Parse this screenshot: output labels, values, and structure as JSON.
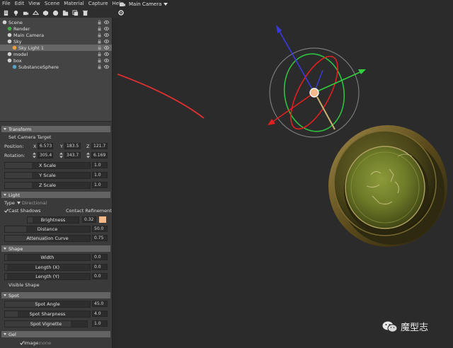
{
  "menu": [
    "File",
    "Edit",
    "View",
    "Scene",
    "Material",
    "Capture",
    "Help"
  ],
  "viewport": {
    "camera_label": "Main Camera"
  },
  "outliner": {
    "items": [
      {
        "label": "Scene",
        "depth": 0,
        "selected": false
      },
      {
        "label": "Render",
        "depth": 1,
        "selected": false
      },
      {
        "label": "Main Camera",
        "depth": 1,
        "selected": false
      },
      {
        "label": "Sky",
        "depth": 1,
        "selected": false
      },
      {
        "label": "Sky Light 1",
        "depth": 2,
        "selected": true
      },
      {
        "label": "model",
        "depth": 1,
        "selected": false
      },
      {
        "label": "box",
        "depth": 1,
        "selected": false
      },
      {
        "label": "SubstanceSphere",
        "depth": 2,
        "selected": false
      }
    ]
  },
  "transform": {
    "header": "Transform",
    "set_camera_target": "Set Camera Target",
    "position_label": "Position:",
    "rotation_label": "Rotation:",
    "x_label": "X",
    "y_label": "Y",
    "z_label": "Z",
    "position": {
      "x": "6.573",
      "y": "183.5",
      "z": "121.7"
    },
    "rotation": {
      "x": "305.4",
      "y": "343.7",
      "z": "6.169"
    },
    "x_scale": {
      "label": "X Scale",
      "value": "1.0"
    },
    "y_scale": {
      "label": "Y Scale",
      "value": "1.0"
    },
    "z_scale": {
      "label": "Z Scale",
      "value": "1.0"
    }
  },
  "light": {
    "header": "Light",
    "type_label": "Type",
    "type_value": "Directional",
    "cast_shadows": "Cast Shadows",
    "contact_refinement": "Contact Refinement",
    "brightness": {
      "label": "Brightness",
      "value": "0.32",
      "fill": 0.1
    },
    "distance": {
      "label": "Distance",
      "value": "50.0",
      "fill": 0.25
    },
    "attenuation": {
      "label": "Attenuation Curve",
      "value": "0.75",
      "fill": 0.5
    },
    "color": "#f5b98a"
  },
  "shape": {
    "header": "Shape",
    "width": {
      "label": "Width",
      "value": "0.0"
    },
    "length_x": {
      "label": "Length (X)",
      "value": "0.0"
    },
    "length_y": {
      "label": "Length (Y)",
      "value": "0.0"
    },
    "visible_shape": "Visible Shape"
  },
  "spot": {
    "header": "Spot",
    "angle": {
      "label": "Spot Angle",
      "value": "45.0",
      "fill": 0.4
    },
    "sharpness": {
      "label": "Spot Sharpness",
      "value": "4.0",
      "fill": 0.15
    },
    "vignette": {
      "label": "Spot Vignette",
      "value": "1.0",
      "fill": 0.8
    }
  },
  "gel": {
    "header": "Gel",
    "image_label": "Image:",
    "image_value": "none"
  },
  "watermark": {
    "text": "魔型志"
  },
  "colors": {
    "annotation_arrow": "#e03030",
    "gizmo_blue": "#3a3ae0",
    "gizmo_green": "#30d040",
    "gizmo_red": "#e02020"
  }
}
